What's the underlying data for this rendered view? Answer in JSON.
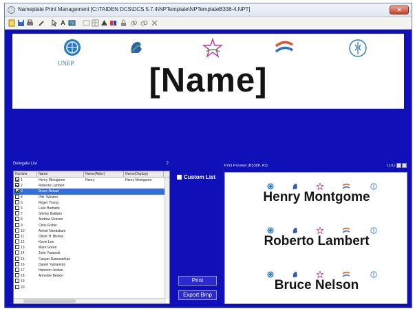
{
  "window": {
    "title": "Nameplate Print Management [C:\\TAIDEN DCS\\DCS 5.7.4\\NPTemplate\\NPTemplateB338-4.NPT]",
    "close_label": "✕"
  },
  "toolbar": {
    "icons": [
      "new-icon",
      "save-icon",
      "print-setup-icon",
      "tools-icon",
      "pointer-icon",
      "text-icon",
      "image-icon",
      "align-icon",
      "table-icon",
      "bring-front-icon",
      "color-icon",
      "lock-icon",
      "link-icon",
      "unlink-icon",
      "delete-icon"
    ]
  },
  "nameplate": {
    "unep_label": "UNEP",
    "name_field": "[Name]"
  },
  "delegate_list": {
    "title": "Delegate List",
    "count": "2",
    "columns": [
      "Number",
      "Name",
      "Name(Abbr.)",
      "Name(Display)"
    ],
    "rows": [
      {
        "number": "1",
        "name": "Henry Montgome",
        "abbr": "Henry",
        "display": "Henry Montgome",
        "checked": true,
        "selected": false
      },
      {
        "number": "2",
        "name": "Roberto Lambert",
        "abbr": "",
        "display": "",
        "checked": true,
        "selected": false
      },
      {
        "number": "3",
        "name": "Bruce Nelson",
        "abbr": "",
        "display": "",
        "checked": true,
        "selected": true
      },
      {
        "number": "4",
        "name": "Phil. Weston",
        "abbr": "",
        "display": "",
        "checked": false,
        "selected": false
      },
      {
        "number": "5",
        "name": "Roger Young",
        "abbr": "",
        "display": "",
        "checked": false,
        "selected": false
      },
      {
        "number": "6",
        "name": "Luke Burbank",
        "abbr": "",
        "display": "",
        "checked": false,
        "selected": false
      },
      {
        "number": "7",
        "name": "Shirley Baldwin",
        "abbr": "",
        "display": "",
        "checked": false,
        "selected": false
      },
      {
        "number": "8",
        "name": "Andrew Reeves",
        "abbr": "",
        "display": "",
        "checked": false,
        "selected": false
      },
      {
        "number": "9",
        "name": "Chris Fisher",
        "abbr": "",
        "display": "",
        "checked": false,
        "selected": false
      },
      {
        "number": "10",
        "name": "Ashok Nandakum",
        "abbr": "",
        "display": "",
        "checked": false,
        "selected": false
      },
      {
        "number": "11",
        "name": "Oliver H. Bishop",
        "abbr": "",
        "display": "",
        "checked": false,
        "selected": false
      },
      {
        "number": "12",
        "name": "Kevin Lee",
        "abbr": "",
        "display": "",
        "checked": false,
        "selected": false
      },
      {
        "number": "13",
        "name": "Mark Green",
        "abbr": "",
        "display": "",
        "checked": false,
        "selected": false
      },
      {
        "number": "14",
        "name": "John Yaraoski",
        "abbr": "",
        "display": "",
        "checked": false,
        "selected": false
      },
      {
        "number": "15",
        "name": "Caspar Ramanathan",
        "abbr": "",
        "display": "",
        "checked": false,
        "selected": false
      },
      {
        "number": "16",
        "name": "Daniel Yamamoto",
        "abbr": "",
        "display": "",
        "checked": false,
        "selected": false
      },
      {
        "number": "17",
        "name": "Harrison Jordan",
        "abbr": "",
        "display": "",
        "checked": false,
        "selected": false
      },
      {
        "number": "18",
        "name": "Annelise Becker",
        "abbr": "",
        "display": "",
        "checked": false,
        "selected": false
      },
      {
        "number": "19",
        "name": "",
        "abbr": "",
        "display": "",
        "checked": false,
        "selected": false
      },
      {
        "number": "20",
        "name": "",
        "abbr": "",
        "display": "",
        "checked": false,
        "selected": false
      }
    ]
  },
  "controls": {
    "custom_list_label": "Custom List",
    "print_label": "Print",
    "export_label": "Export Bmp"
  },
  "print_preview": {
    "title": "Print Preview (B338P, A3)",
    "page_indicator": "(1/1)",
    "cards": [
      "Henry Montgome",
      "Roberto Lambert",
      "Bruce Nelson"
    ]
  },
  "colors": {
    "background": "#1010b8",
    "selection": "#3470d8"
  }
}
